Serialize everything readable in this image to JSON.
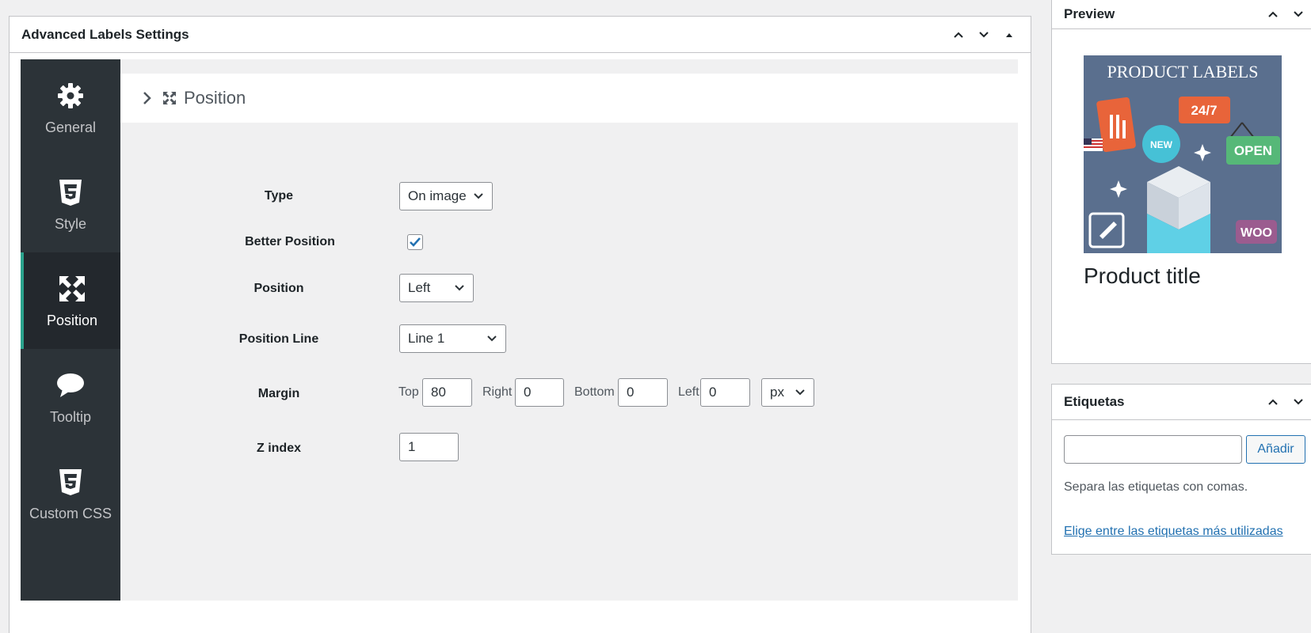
{
  "main_box": {
    "title": "Advanced Labels Settings"
  },
  "tabs": [
    {
      "label": "General",
      "icon": "gear-icon"
    },
    {
      "label": "Style",
      "icon": "css3-icon"
    },
    {
      "label": "Position",
      "icon": "arrows-expand-icon",
      "active": true
    },
    {
      "label": "Tooltip",
      "icon": "speech-bubble-icon"
    },
    {
      "label": "Custom CSS",
      "icon": "css3-icon"
    }
  ],
  "section": {
    "title": "Position"
  },
  "form": {
    "type_label": "Type",
    "type_value": "On image",
    "better_position_label": "Better Position",
    "better_position_checked": true,
    "position_label": "Position",
    "position_value": "Left",
    "position_line_label": "Position Line",
    "position_line_value": "Line 1",
    "margin_label": "Margin",
    "margin_top_label": "Top",
    "margin_top": "80",
    "margin_right_label": "Right",
    "margin_right": "0",
    "margin_bottom_label": "Bottom",
    "margin_bottom": "0",
    "margin_left_label": "Left",
    "margin_left": "0",
    "margin_unit": "px",
    "zindex_label": "Z index",
    "zindex_value": "1"
  },
  "preview_box": {
    "title": "Preview",
    "image_heading": "PRODUCT LABELS",
    "badge_247": "24/7",
    "badge_new": "NEW",
    "badge_open": "OPEN",
    "badge_woo": "WOO",
    "product_title": "Product title"
  },
  "tags_box": {
    "title": "Etiquetas",
    "add_button": "Añadir",
    "help_text": "Separa las etiquetas con comas.",
    "link_text": "Elige entre las etiquetas más utilizadas"
  },
  "colors": {
    "sidebar_bg": "#2c3338",
    "active_accent": "#2aa28c",
    "link": "#2271b1"
  }
}
